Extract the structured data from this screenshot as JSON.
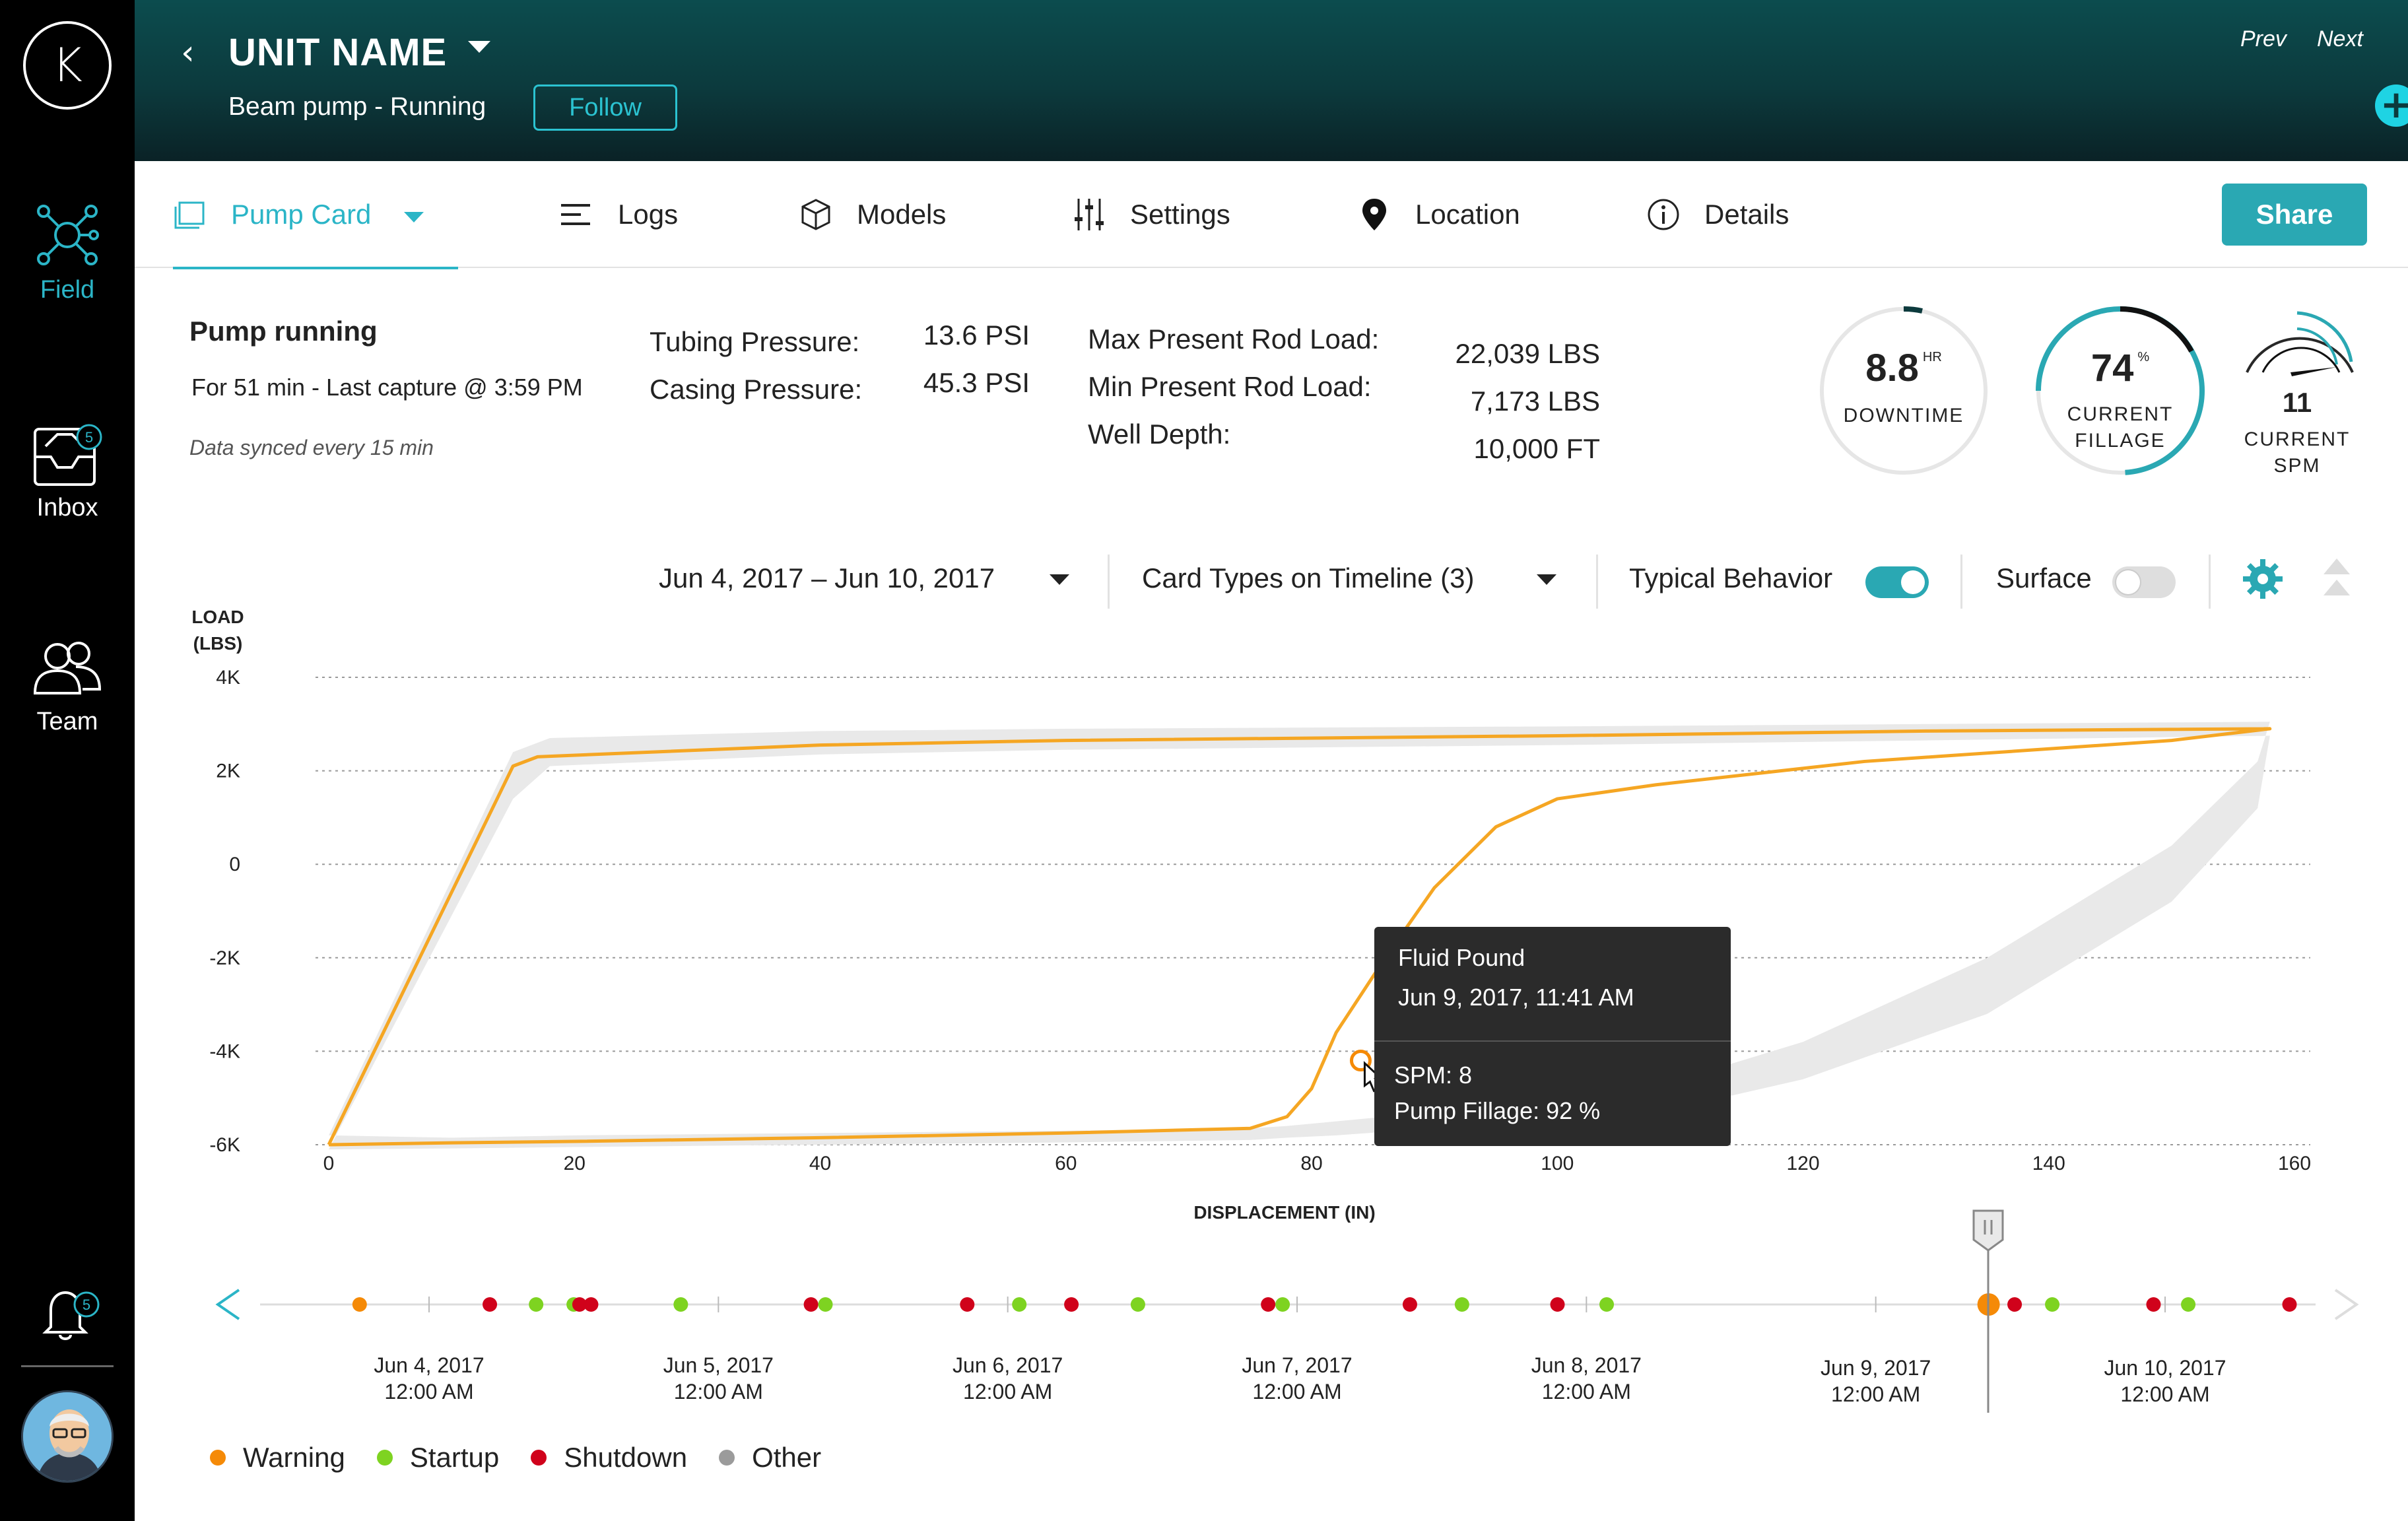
{
  "colors": {
    "accent": "#2bb5c7",
    "topbar_dark": "#0c3a3d",
    "warning": "#f58a07",
    "startup": "#7ed321",
    "shutdown": "#d0021b",
    "other": "#9b9b9b",
    "curve": "#f5a623",
    "typical_band": "#e9e9e9"
  },
  "sidebar": {
    "logo": "K",
    "items": [
      {
        "label": "Field",
        "icon": "network-icon",
        "active": true
      },
      {
        "label": "Inbox",
        "icon": "inbox-icon",
        "badge": "5"
      },
      {
        "label": "Team",
        "icon": "team-icon"
      }
    ],
    "notifications_badge": "5"
  },
  "header": {
    "title": "UNIT NAME",
    "subtitle": "Beam pump - Running",
    "follow_label": "Follow",
    "prev_label": "Prev",
    "next_label": "Next"
  },
  "tabs": [
    {
      "label": "Pump Card",
      "icon": "pump-card-icon",
      "active": true
    },
    {
      "label": "Logs",
      "icon": "logs-icon"
    },
    {
      "label": "Models",
      "icon": "cube-icon"
    },
    {
      "label": "Settings",
      "icon": "sliders-icon"
    },
    {
      "label": "Location",
      "icon": "location-pin-icon"
    },
    {
      "label": "Details",
      "icon": "info-icon"
    }
  ],
  "share_label": "Share",
  "status": {
    "title": "Pump running",
    "detail": "For 51 min - Last capture @ 3:59 PM",
    "sync": "Data synced every 15 min"
  },
  "pressures": [
    {
      "label": "Tubing Pressure:",
      "value": "13.6 PSI"
    },
    {
      "label": "Casing Pressure:",
      "value": "45.3 PSI"
    }
  ],
  "rod_stats": [
    {
      "label": "Max Present Rod Load:",
      "value": "22,039 LBS"
    },
    {
      "label": "Min Present Rod Load:",
      "value": "7,173 LBS"
    },
    {
      "label": "Well Depth:",
      "value": "10,000 FT"
    }
  ],
  "gauges": {
    "downtime": {
      "value": "8.8",
      "unit": "HR",
      "label": "DOWNTIME"
    },
    "fillage": {
      "value": "74",
      "unit": "%",
      "label_line1": "CURRENT",
      "label_line2": "FILLAGE",
      "fraction": 0.74
    },
    "spm": {
      "value": "11",
      "label_line1": "CURRENT",
      "label_line2": "SPM"
    }
  },
  "filters": {
    "date_range": "Jun 4, 2017 – Jun 10, 2017",
    "card_types": "Card Types on Timeline (3)",
    "typical_label": "Typical Behavior",
    "typical_on": true,
    "surface_label": "Surface",
    "surface_on": false
  },
  "chart_data": {
    "type": "line",
    "xlabel": "DISPLACEMENT (IN)",
    "ylabel_line1": "LOAD",
    "ylabel_line2": "(LBS)",
    "x_ticks": [
      "0",
      "20",
      "40",
      "60",
      "80",
      "100",
      "120",
      "140",
      "160"
    ],
    "y_ticks": [
      "4K",
      "2K",
      "0",
      "-2K",
      "-4K",
      "-6K"
    ],
    "y_tick_values": [
      4000,
      2000,
      0,
      -2000,
      -4000,
      -6000
    ],
    "xlim": [
      0,
      160
    ],
    "ylim": [
      -6000,
      4000
    ],
    "series": [
      {
        "x": [
          0,
          15,
          17,
          40,
          60,
          100,
          130,
          158,
          150,
          125,
          108,
          100,
          95,
          90,
          86,
          82,
          80,
          78,
          75,
          60,
          40,
          20,
          10,
          0
        ],
        "y": [
          -6000,
          2100,
          2300,
          2550,
          2650,
          2750,
          2850,
          2900,
          2650,
          2200,
          1700,
          1400,
          800,
          -500,
          -2000,
          -3600,
          -4800,
          -5400,
          -5650,
          -5750,
          -5850,
          -5930,
          -5960,
          -6000
        ]
      }
    ],
    "typical_band": {
      "x": [
        0,
        15,
        18,
        40,
        60,
        100,
        130,
        158,
        157,
        150,
        135,
        120,
        110,
        100,
        90,
        82,
        78,
        75,
        60,
        40,
        20,
        10,
        0
      ],
      "y_upper": [
        -5800,
        2400,
        2700,
        2850,
        2900,
        2950,
        3000,
        3050,
        2200,
        400,
        -2000,
        -3800,
        -4600,
        -5100,
        -5300,
        -5500,
        -5600,
        -5650,
        -5700,
        -5750,
        -5800,
        -5850,
        -5800
      ],
      "y_lower": [
        -6100,
        1400,
        2100,
        2350,
        2450,
        2550,
        2650,
        2750,
        1200,
        -800,
        -3200,
        -4600,
        -5200,
        -5500,
        -5650,
        -5800,
        -5850,
        -5900,
        -5950,
        -6000,
        -6050,
        -6080,
        -6100
      ]
    },
    "highlight": {
      "x": 84,
      "y": -4200
    }
  },
  "tooltip": {
    "title": "Fluid Pound",
    "date": "Jun 9, 2017, 11:41 AM",
    "spm": "SPM: 8",
    "fillage": "Pump Fillage: 92 %"
  },
  "timeline": {
    "dates": [
      {
        "line1": "Jun 4, 2017",
        "line2": "12:00 AM"
      },
      {
        "line1": "Jun 5, 2017",
        "line2": "12:00 AM"
      },
      {
        "line1": "Jun 6, 2017",
        "line2": "12:00 AM"
      },
      {
        "line1": "Jun 7, 2017",
        "line2": "12:00 AM"
      },
      {
        "line1": "Jun 8, 2017",
        "line2": "12:00 AM"
      },
      {
        "line1": "Jun 9, 2017",
        "line2": "12:00 AM"
      },
      {
        "line1": "Jun 10, 2017",
        "line2": "12:00 AM"
      }
    ],
    "events": [
      {
        "day": 3.76,
        "type": "warning"
      },
      {
        "day": 4.21,
        "type": "shutdown"
      },
      {
        "day": 4.37,
        "type": "startup"
      },
      {
        "day": 4.5,
        "type": "startup"
      },
      {
        "day": 4.52,
        "type": "shutdown"
      },
      {
        "day": 4.56,
        "type": "shutdown"
      },
      {
        "day": 4.87,
        "type": "startup"
      },
      {
        "day": 5.32,
        "type": "shutdown"
      },
      {
        "day": 5.37,
        "type": "startup"
      },
      {
        "day": 5.86,
        "type": "shutdown"
      },
      {
        "day": 6.04,
        "type": "startup"
      },
      {
        "day": 6.22,
        "type": "shutdown"
      },
      {
        "day": 6.45,
        "type": "startup"
      },
      {
        "day": 6.9,
        "type": "shutdown"
      },
      {
        "day": 6.95,
        "type": "startup"
      },
      {
        "day": 7.39,
        "type": "shutdown"
      },
      {
        "day": 7.57,
        "type": "startup"
      },
      {
        "day": 7.9,
        "type": "shutdown"
      },
      {
        "day": 8.07,
        "type": "startup"
      },
      {
        "day": 9.39,
        "type": "warning",
        "selected": true
      },
      {
        "day": 9.48,
        "type": "shutdown"
      },
      {
        "day": 9.61,
        "type": "startup"
      },
      {
        "day": 9.96,
        "type": "shutdown"
      },
      {
        "day": 10.08,
        "type": "startup"
      },
      {
        "day": 10.43,
        "type": "shutdown"
      }
    ]
  },
  "legend": [
    {
      "label": "Warning",
      "color": "#f58a07"
    },
    {
      "label": "Startup",
      "color": "#7ed321"
    },
    {
      "label": "Shutdown",
      "color": "#d0021b"
    },
    {
      "label": "Other",
      "color": "#9b9b9b"
    }
  ]
}
